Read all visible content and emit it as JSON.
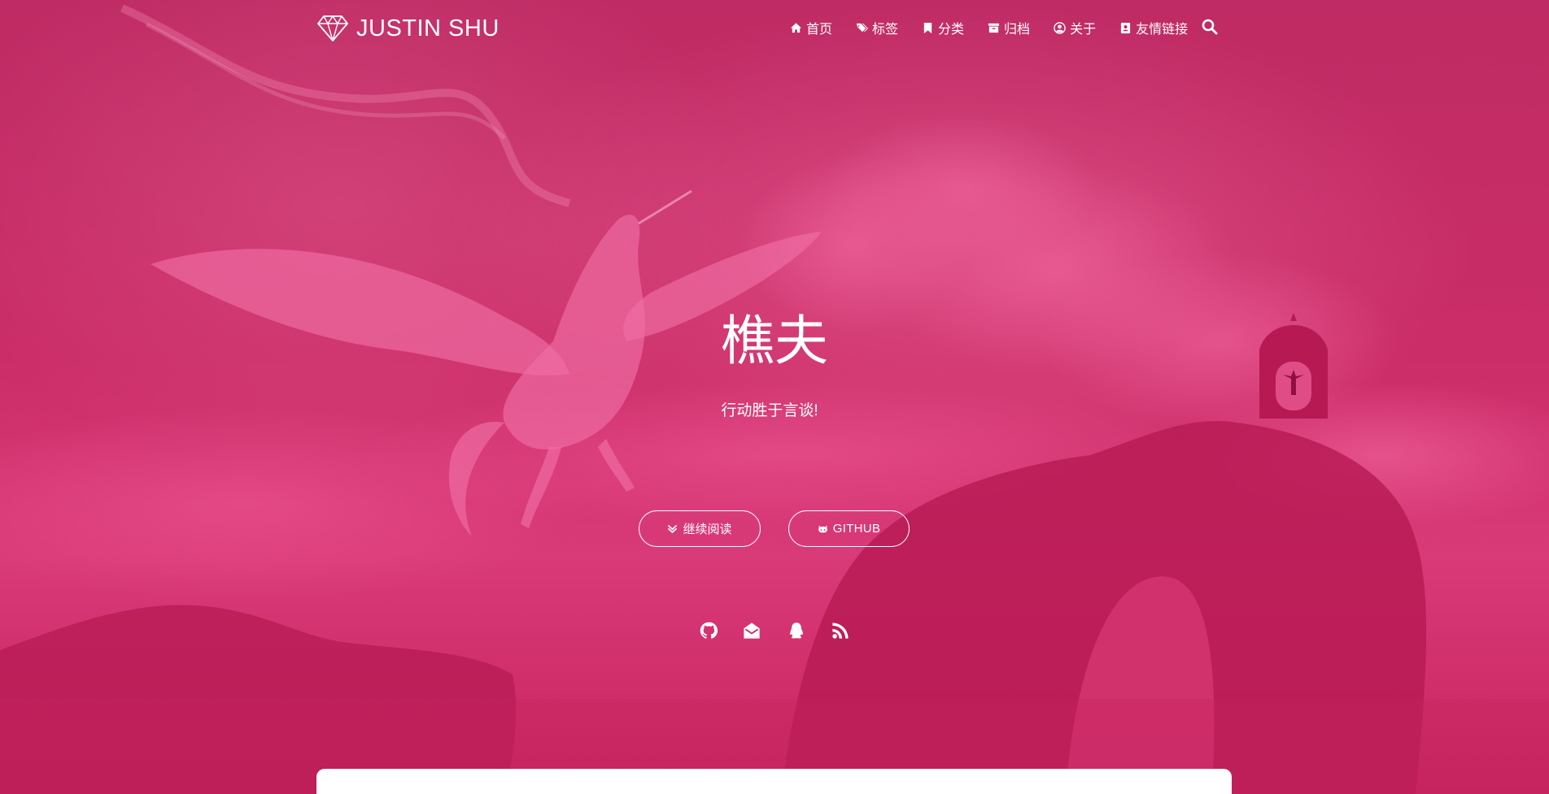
{
  "site": {
    "brand": "JUSTIN SHU"
  },
  "nav": {
    "items": [
      {
        "label": "首页",
        "icon": "home-icon"
      },
      {
        "label": "标签",
        "icon": "tags-icon"
      },
      {
        "label": "分类",
        "icon": "bookmark-icon"
      },
      {
        "label": "归档",
        "icon": "archive-icon"
      },
      {
        "label": "关于",
        "icon": "user-circle-icon"
      },
      {
        "label": "友情链接",
        "icon": "address-book-icon"
      }
    ],
    "search_icon": "search-icon"
  },
  "hero": {
    "title": "樵夫",
    "subtitle": "行动胜于言谈!",
    "read_more_label": "继续阅读",
    "github_label": "GITHUB"
  },
  "social": [
    "github-icon",
    "mail-icon",
    "qq-icon",
    "rss-icon"
  ],
  "colors": {
    "overlay": "#c7245f",
    "accent": "#ffffff"
  }
}
